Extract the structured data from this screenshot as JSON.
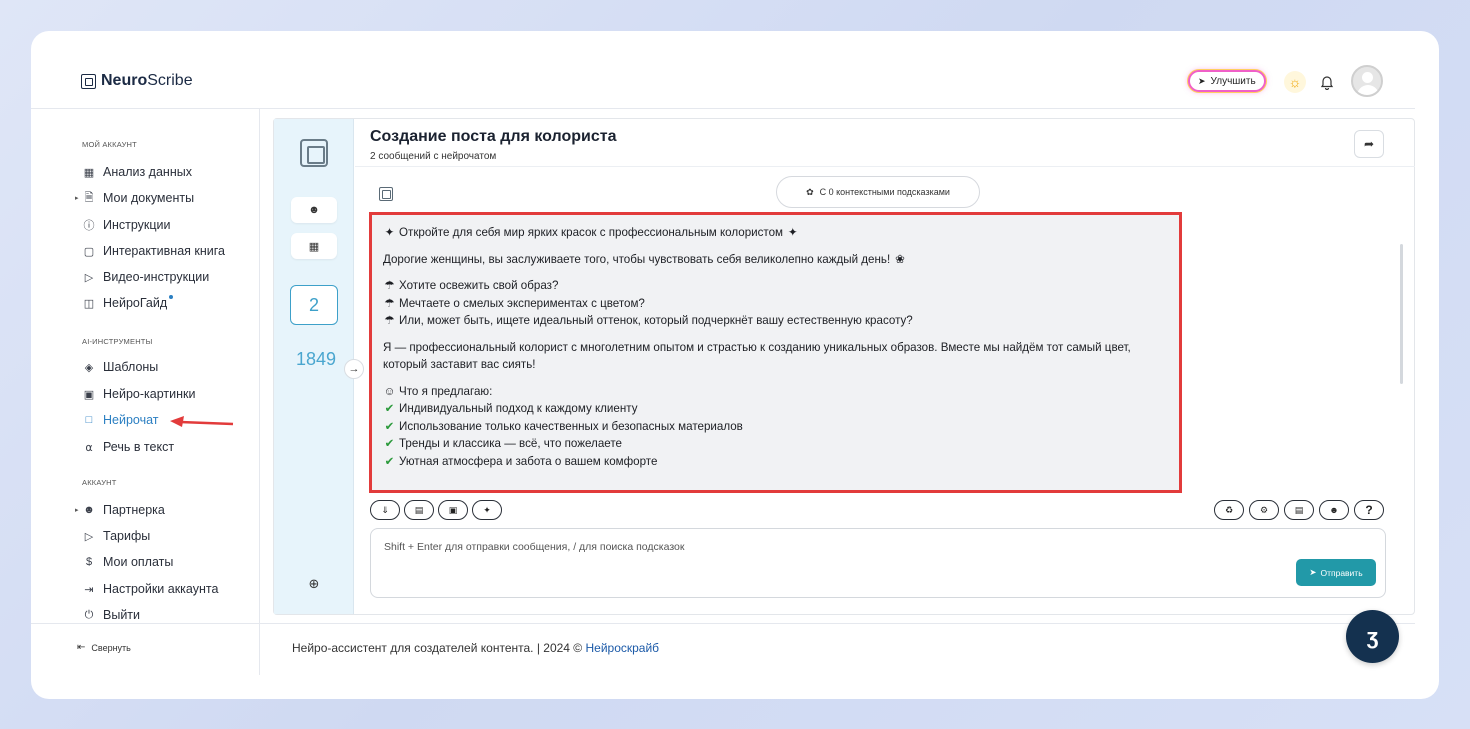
{
  "header": {
    "brand_bold": "Neuro",
    "brand_light": "Scribe",
    "upgrade_label": "Улучшить"
  },
  "sidebar": {
    "section_account": "МОЙ АККАУНТ",
    "account_items": [
      {
        "label": "Анализ данных",
        "icon": "grid-icon"
      },
      {
        "label": "Мои документы",
        "icon": "document-icon"
      },
      {
        "label": "Инструкции",
        "icon": "help-circle-icon"
      },
      {
        "label": "Интерактивная книга",
        "icon": "book-icon"
      },
      {
        "label": "Видео-инструкции",
        "icon": "video-icon"
      },
      {
        "label": "НейроГайд",
        "icon": "guide-icon"
      }
    ],
    "section_ai": "AI-ИНСТРУМЕНТЫ",
    "ai_items": [
      {
        "label": "Шаблоны",
        "icon": "layers-icon"
      },
      {
        "label": "Нейро-картинки",
        "icon": "image-icon"
      },
      {
        "label": "Нейрочат",
        "icon": "chat-icon"
      },
      {
        "label": "Речь в текст",
        "icon": "headphones-icon"
      }
    ],
    "section_acc": "АККАУНТ",
    "acc_items": [
      {
        "label": "Партнерка",
        "icon": "users-icon"
      },
      {
        "label": "Тарифы",
        "icon": "tag-icon"
      },
      {
        "label": "Мои оплаты",
        "icon": "dollar-icon"
      },
      {
        "label": "Настройки аккаунта",
        "icon": "settings-icon"
      },
      {
        "label": "Выйти",
        "icon": "power-icon"
      }
    ],
    "collapse_label": "Свернуть"
  },
  "rail": {
    "count": "2",
    "number": "1849"
  },
  "chat": {
    "title": "Создание поста для колориста",
    "subtitle": "2 сообщений с нейрочатом",
    "hints_label": "С 0 контекстными подсказками",
    "message": {
      "line1": "Откройте для себя мир ярких красок с профессиональным колористом",
      "line2": "Дорогие женщины, вы заслуживаете того, чтобы чувствовать себя великолепно каждый день!",
      "q1": "Хотите освежить свой образ?",
      "q2": "Мечтаете о смелых экспериментах с цветом?",
      "q3": "Или, может быть, ищете идеальный оттенок, который подчеркнёт вашу естественную красоту?",
      "para": "Я — профессиональный колорист с многолетним опытом и страстью к созданию уникальных образов. Вместе мы найдём тот самый цвет, который заставит вас сиять!",
      "offer": "Что я предлагаю:",
      "c1": "Индивидуальный подход к каждому клиенту",
      "c2": "Использование только качественных и безопасных материалов",
      "c3": "Тренды и классика — всё, что пожелаете",
      "c4": "Уютная атмосфера и забота о вашем комфорте"
    },
    "input_placeholder": "Shift + Enter для отправки сообщения, / для поиска подсказок",
    "send_label": "Отправить",
    "help_label": "?"
  },
  "footer": {
    "text": "Нейро-ассистент для создателей контента.  | 2024 © ",
    "link": "Нейроскрайб"
  },
  "colors": {
    "accent": "#2b7fc2",
    "send": "#2299a8",
    "highlight": "#e23b3b"
  }
}
